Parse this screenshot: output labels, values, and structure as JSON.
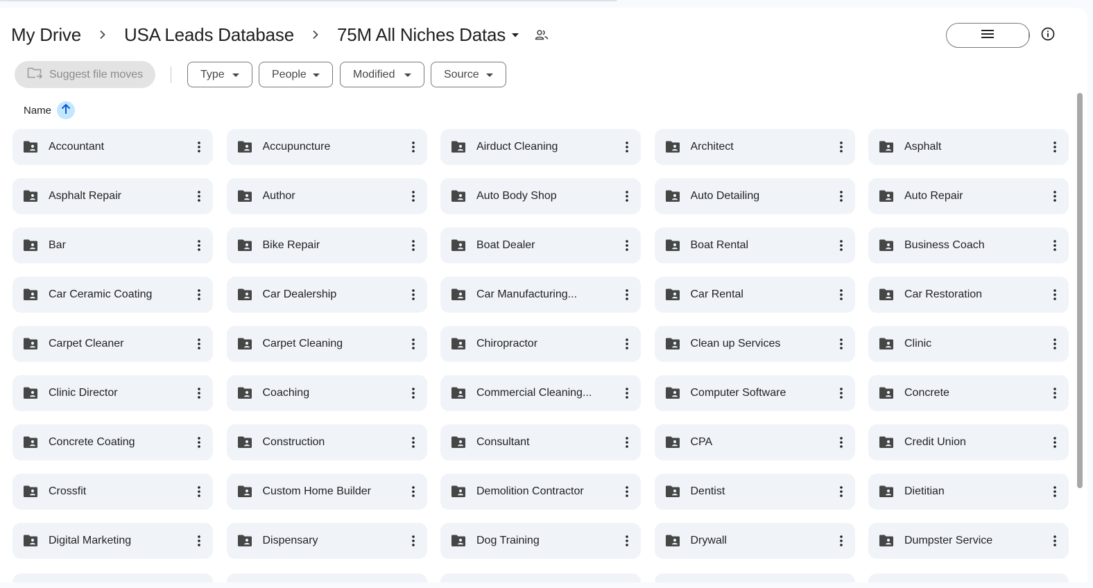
{
  "breadcrumb": {
    "items": [
      "My Drive",
      "USA Leads Database"
    ],
    "current": "75M All Niches Datas"
  },
  "toolbar": {
    "suggest_label": "Suggest file moves",
    "filters": [
      "Type",
      "People",
      "Modified",
      "Source"
    ]
  },
  "sort": {
    "label": "Name"
  },
  "folders": [
    "Accountant",
    "Accupuncture",
    "Airduct Cleaning",
    "Architect",
    "Asphalt",
    "Asphalt Repair",
    "Author",
    "Auto Body Shop",
    "Auto Detailing",
    "Auto Repair",
    "Bar",
    "Bike Repair",
    "Boat Dealer",
    "Boat Rental",
    "Business Coach",
    "Car Ceramic Coating",
    "Car Dealership",
    "Car Manufacturing...",
    "Car Rental",
    "Car Restoration",
    "Carpet Cleaner",
    "Carpet Cleaning",
    "Chiropractor",
    "Clean up Services",
    "Clinic",
    "Clinic Director",
    "Coaching",
    "Commercial Cleaning...",
    "Computer Software",
    "Concrete",
    "Concrete Coating",
    "Construction",
    "Consultant",
    "CPA",
    "Credit Union",
    "Crossfit",
    "Custom Home Builder",
    "Demolition Contractor",
    "Dentist",
    "Dietitian",
    "Digital Marketing",
    "Dispensary",
    "Dog Training",
    "Drywall",
    "Dumpster Service"
  ],
  "colors": {
    "accent": "#c2e7ff",
    "card_bg": "#f0f4f9",
    "icon": "#444746"
  }
}
